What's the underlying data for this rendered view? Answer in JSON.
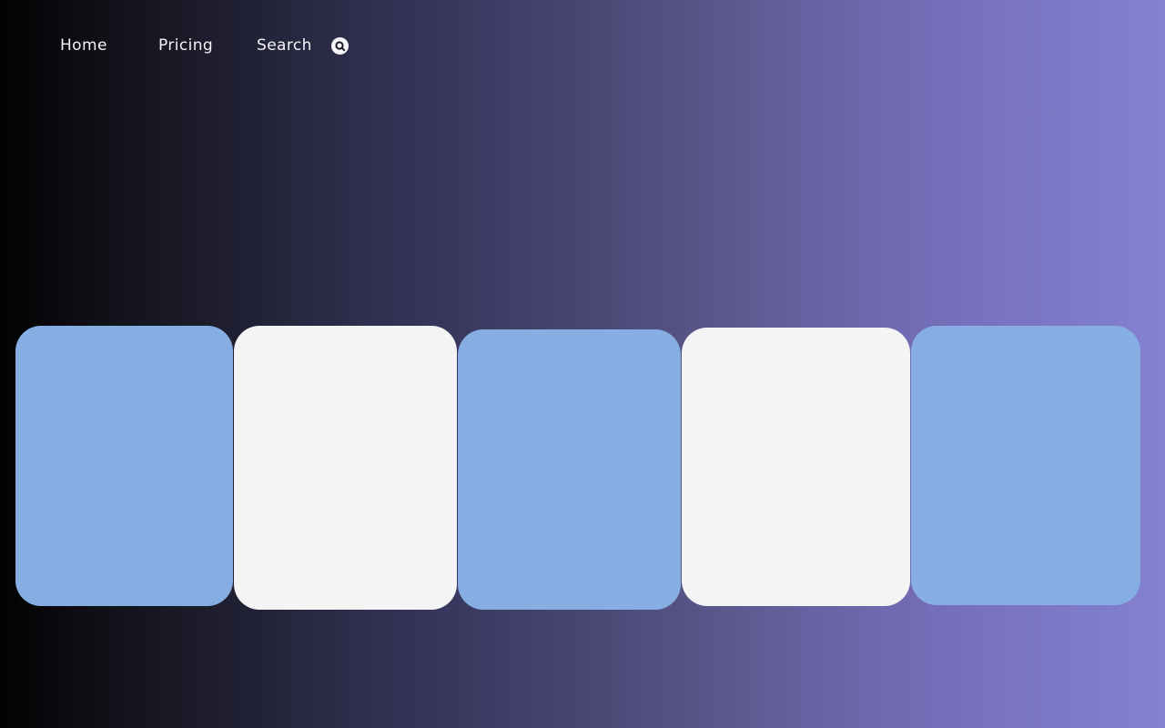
{
  "nav": {
    "items": [
      {
        "label": "Home"
      },
      {
        "label": "Pricing"
      },
      {
        "label": "Search"
      }
    ],
    "search_icon": "search-icon"
  },
  "cards": [
    {
      "color": "#87aee3"
    },
    {
      "color": "#f4f4f4"
    },
    {
      "color": "#87aee3"
    },
    {
      "color": "#f4f4f4"
    },
    {
      "color": "#87aee3"
    }
  ],
  "colors": {
    "gradient_start": "#020203",
    "gradient_end": "#8382d1",
    "nav_text": "#f4f4f8"
  }
}
